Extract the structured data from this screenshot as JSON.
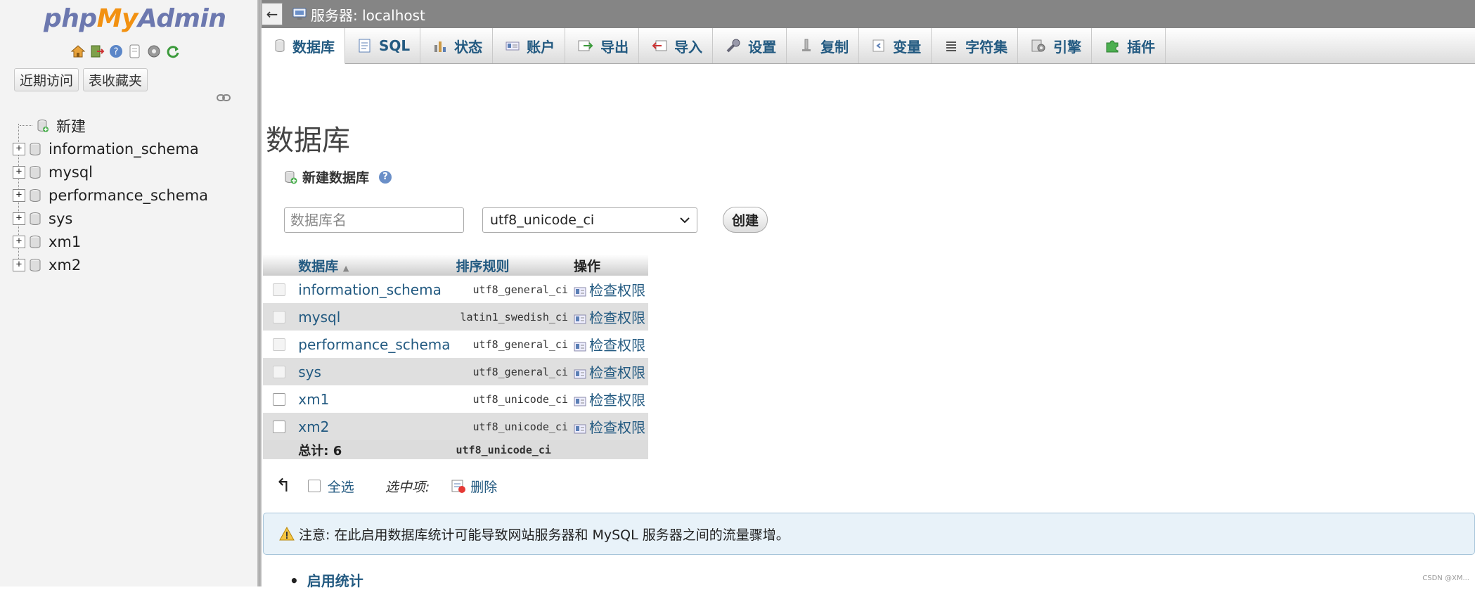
{
  "sidebar": {
    "logo": {
      "php": "php",
      "my": "My",
      "admin": "Admin"
    },
    "nav_icons": [
      "home-icon",
      "exit-icon",
      "help-icon",
      "docs-icon",
      "settings-icon",
      "reload-icon"
    ],
    "recent_label": "近期访问",
    "favorites_label": "表收藏夹",
    "tree": [
      {
        "label": "新建",
        "icon": "new-db-icon"
      },
      {
        "label": "information_schema",
        "icon": "database-icon"
      },
      {
        "label": "mysql",
        "icon": "database-icon"
      },
      {
        "label": "performance_schema",
        "icon": "database-icon"
      },
      {
        "label": "sys",
        "icon": "database-icon"
      },
      {
        "label": "xm1",
        "icon": "database-icon"
      },
      {
        "label": "xm2",
        "icon": "database-icon"
      }
    ]
  },
  "topbar": {
    "back_glyph": "←",
    "server_label": "服务器: localhost"
  },
  "tabs": [
    {
      "label": "数据库",
      "icon": "database-icon",
      "active": true
    },
    {
      "label": "SQL",
      "icon": "sql-icon"
    },
    {
      "label": "状态",
      "icon": "status-icon"
    },
    {
      "label": "账户",
      "icon": "accounts-icon"
    },
    {
      "label": "导出",
      "icon": "export-icon"
    },
    {
      "label": "导入",
      "icon": "import-icon"
    },
    {
      "label": "设置",
      "icon": "settings-icon"
    },
    {
      "label": "复制",
      "icon": "replication-icon"
    },
    {
      "label": "变量",
      "icon": "variables-icon"
    },
    {
      "label": "字符集",
      "icon": "charset-icon"
    },
    {
      "label": "引擎",
      "icon": "engine-icon"
    },
    {
      "label": "插件",
      "icon": "plugin-icon"
    }
  ],
  "main": {
    "page_title": "数据库",
    "create_section_title": "新建数据库",
    "db_name_placeholder": "数据库名",
    "collation_selected": "utf8_unicode_ci",
    "create_button": "创建",
    "table": {
      "headers": {
        "database": "数据库",
        "sort_arrow": "▲",
        "collation": "排序规则",
        "action": "操作"
      },
      "rows": [
        {
          "name": "information_schema",
          "collation": "utf8_general_ci",
          "action": "检查权限",
          "checkbox_enabled": false
        },
        {
          "name": "mysql",
          "collation": "latin1_swedish_ci",
          "action": "检查权限",
          "checkbox_enabled": false
        },
        {
          "name": "performance_schema",
          "collation": "utf8_general_ci",
          "action": "检查权限",
          "checkbox_enabled": false
        },
        {
          "name": "sys",
          "collation": "utf8_general_ci",
          "action": "检查权限",
          "checkbox_enabled": false
        },
        {
          "name": "xm1",
          "collation": "utf8_unicode_ci",
          "action": "检查权限",
          "checkbox_enabled": true
        },
        {
          "name": "xm2",
          "collation": "utf8_unicode_ci",
          "action": "检查权限",
          "checkbox_enabled": true
        }
      ],
      "total_label": "总计: 6",
      "total_collation": "utf8_unicode_ci"
    },
    "bulk": {
      "select_all": "全选",
      "with_selected": "选中项:",
      "delete": "删除"
    },
    "notice": "注意: 在此启用数据库统计可能导致网站服务器和 MySQL 服务器之间的流量骤增。",
    "enable_stats": "启用统计",
    "watermark": "CSDN @XM..."
  },
  "colors": {
    "link": "#235a81",
    "topbar": "#858585",
    "notice_bg": "#e8f2f9"
  }
}
